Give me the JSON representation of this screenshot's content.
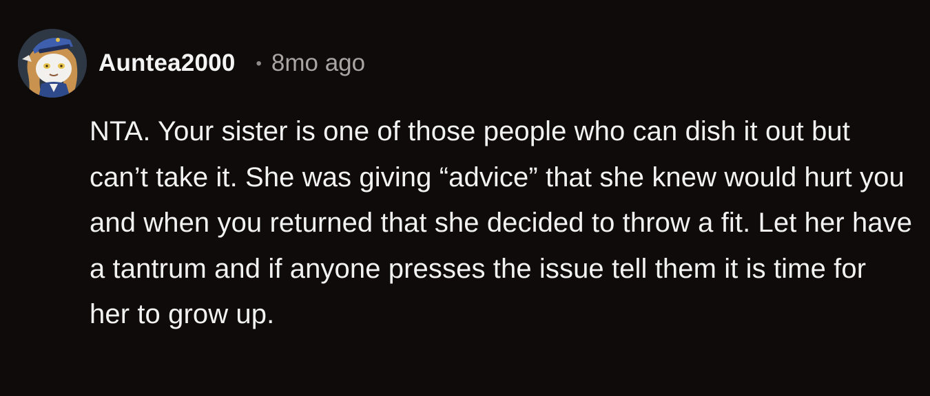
{
  "comment": {
    "username": "Auntea2000",
    "separator": "•",
    "timestamp": "8mo ago",
    "avatar_icon": "snoo-avatar-icon",
    "body": "NTA. Your sister is one of those people who can dish it out but can’t take it. She was giving “advice” that she knew would hurt you and when you returned that she decided to throw a fit. Let her have a tantrum and if anyone presses the issue tell them it is time for her to grow up."
  },
  "colors": {
    "background": "#0f0b0b",
    "username": "#f4f4f4",
    "timestamp": "#aaa4a2",
    "body_text": "#f2f2f2"
  }
}
